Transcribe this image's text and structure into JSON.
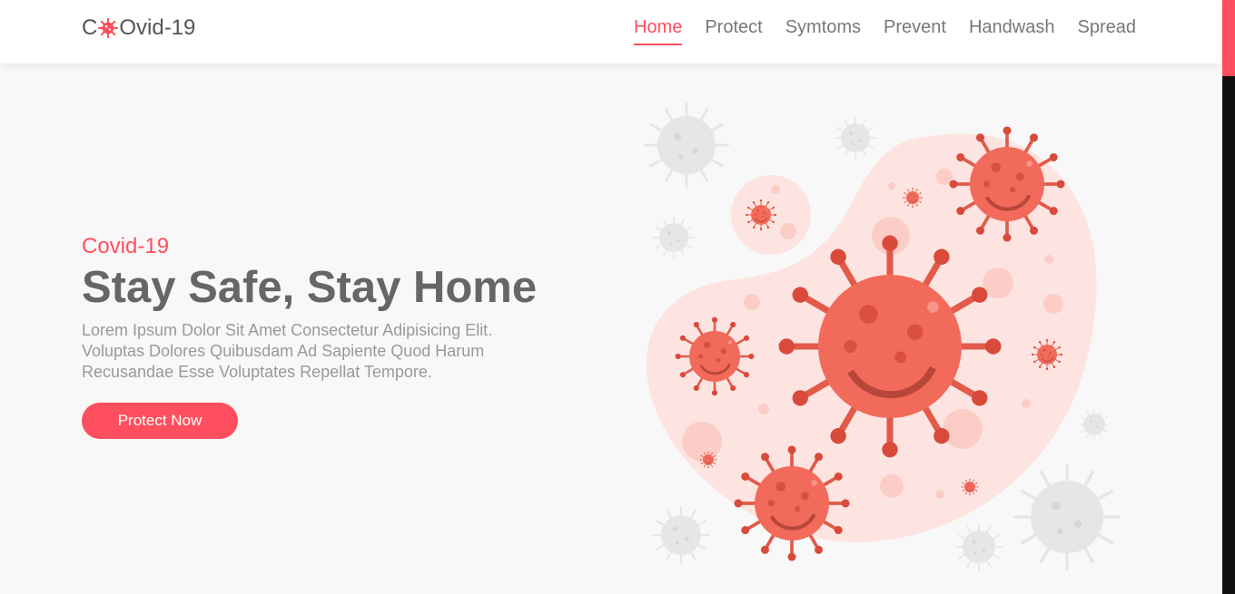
{
  "brand": {
    "prefix": "C",
    "suffix": "Ovid-19",
    "icon": "virus-icon"
  },
  "nav": {
    "items": [
      {
        "label": "Home",
        "active": true
      },
      {
        "label": "Protect",
        "active": false
      },
      {
        "label": "Symtoms",
        "active": false
      },
      {
        "label": "Prevent",
        "active": false
      },
      {
        "label": "Handwash",
        "active": false
      },
      {
        "label": "Spread",
        "active": false
      }
    ]
  },
  "hero": {
    "subtitle": "Covid-19",
    "title": "Stay Safe, Stay Home",
    "description": "Lorem Ipsum Dolor Sit Amet Consectetur Adipisicing Elit. Voluptas Dolores Quibusdam Ad Sapiente Quod Harum Recusandae Esse Voluptates Repellat Tempore.",
    "button_label": "Protect Now"
  },
  "colors": {
    "accent": "#ff4f5e",
    "virus": "#f26a5a",
    "blob": "#fde4e1",
    "grey_virus": "#e6e6e6"
  }
}
